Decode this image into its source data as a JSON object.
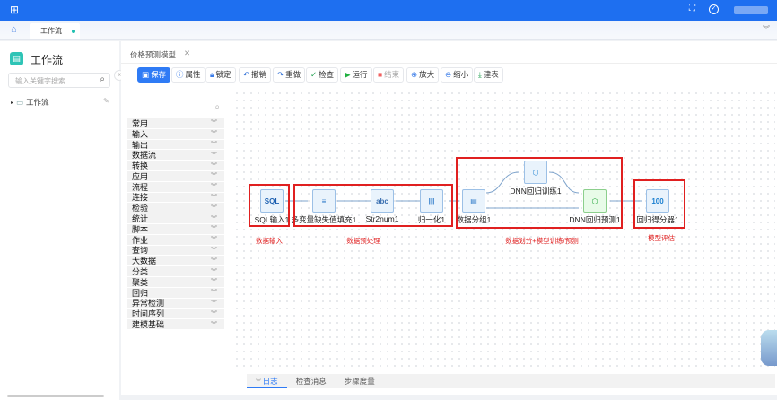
{
  "topbar": {
    "color": "#1e6ff0",
    "icons": [
      "apps-grid-icon",
      "fullscreen-icon",
      "check-circle-icon"
    ],
    "user": "(blurred)"
  },
  "tabbar": {
    "home_icon": "home-icon",
    "tabs": [
      {
        "label": "工作流",
        "active": true
      }
    ]
  },
  "sidebar": {
    "title": "工作流",
    "search_placeholder": "输入关键字搜索",
    "tree": [
      {
        "label": "工作流"
      }
    ]
  },
  "editor": {
    "tab": "价格预测模型",
    "toolbar": [
      {
        "label": "保存",
        "icon": "save-icon",
        "primary": true
      },
      {
        "label": "属性",
        "icon": "info-icon"
      },
      {
        "label": "锁定",
        "icon": "lock-icon"
      },
      {
        "label": "撤销",
        "icon": "undo-icon"
      },
      {
        "label": "重做",
        "icon": "redo-icon"
      },
      {
        "label": "检查",
        "icon": "check-icon"
      },
      {
        "label": "运行",
        "icon": "play-icon"
      },
      {
        "label": "结束",
        "icon": "stop-icon",
        "disabled": true
      },
      {
        "label": "放大",
        "icon": "zoom-in-icon"
      },
      {
        "label": "缩小",
        "icon": "zoom-out-icon"
      },
      {
        "label": "建表",
        "icon": "download-icon"
      }
    ],
    "palette": [
      "常用",
      "输入",
      "输出",
      "数据流",
      "转换",
      "应用",
      "流程",
      "连接",
      "检验",
      "统计",
      "脚本",
      "作业",
      "查询",
      "大数据",
      "分类",
      "聚类",
      "回归",
      "异常检测",
      "时间序列",
      "建模基础"
    ],
    "nodes": [
      {
        "label": "SQL输入1",
        "glyph": "SQL"
      },
      {
        "label": "多变量缺失值填充1",
        "glyph": "≡"
      },
      {
        "label": "Str2num1",
        "glyph": "abc"
      },
      {
        "label": "归一化1",
        "glyph": "|||"
      },
      {
        "label": "数据分组1",
        "glyph": "▤"
      },
      {
        "label": "DNN回归训练1",
        "glyph": "⬡"
      },
      {
        "label": "DNN回归预测1",
        "glyph": "⬡"
      },
      {
        "label": "回归得分器1",
        "glyph": "100"
      }
    ],
    "groups": [
      "数据输入",
      "数据预处理",
      "数据划分+模型训练/预测",
      "模型评估"
    ],
    "bottom_tabs": [
      "日志",
      "检查消息",
      "步骤度量"
    ]
  }
}
